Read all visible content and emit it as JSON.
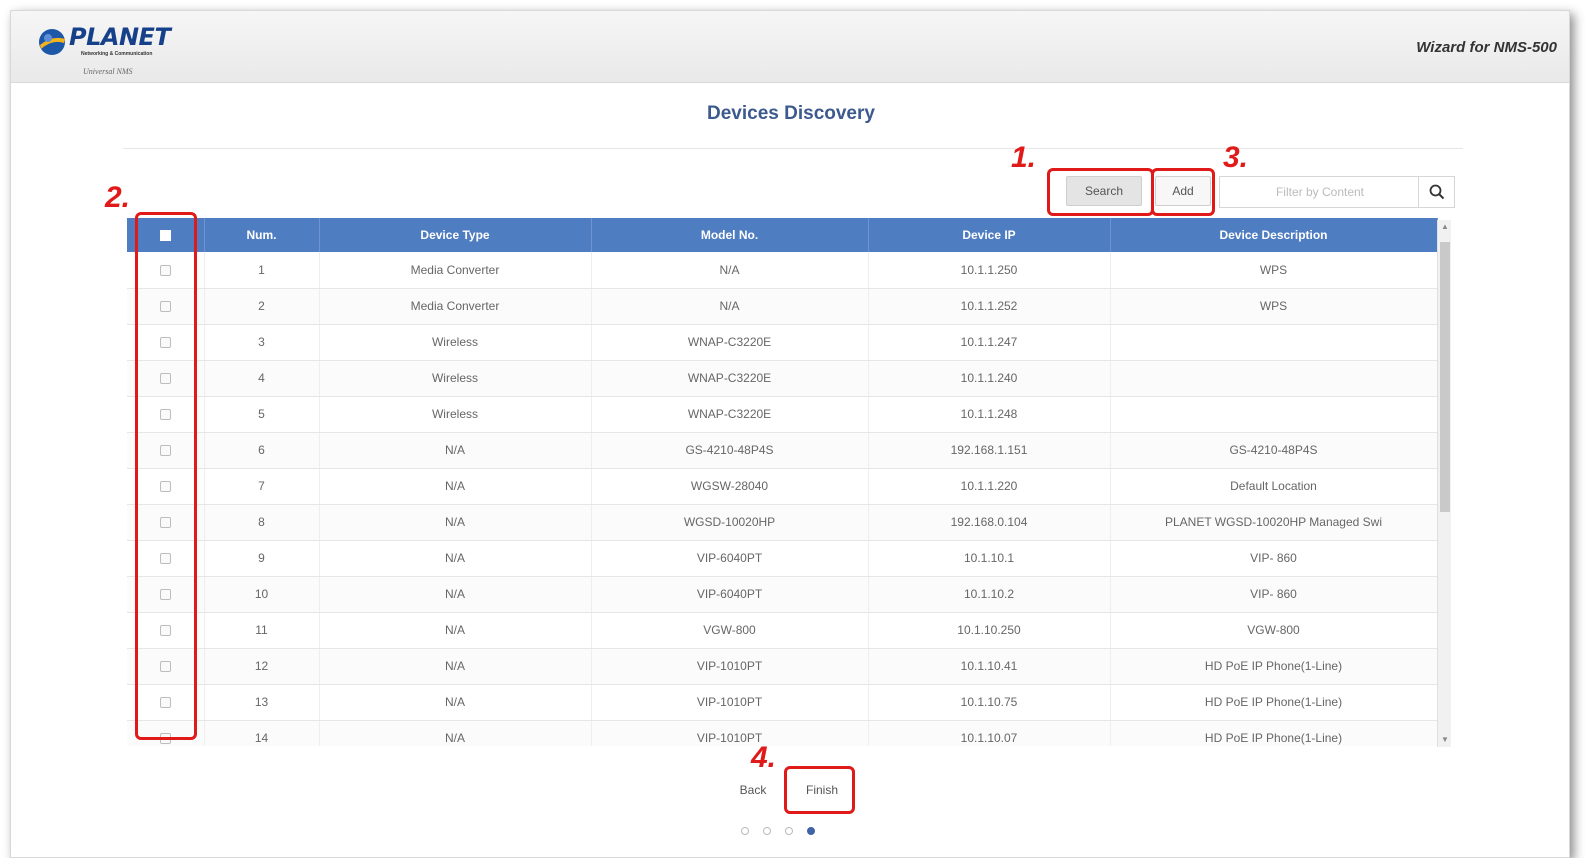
{
  "header": {
    "logo_text": "PLANET",
    "logo_tagline": "Networking & Communication",
    "logo_sub": "Universal NMS",
    "title": "Wizard for NMS-500"
  },
  "page_title": "Devices Discovery",
  "toolbar": {
    "search_label": "Search",
    "add_label": "Add",
    "filter_placeholder": "Filter by Content",
    "filter_icon": "search-icon"
  },
  "table": {
    "columns": [
      "Num.",
      "Device Type",
      "Model No.",
      "Device IP",
      "Device Description"
    ],
    "rows": [
      {
        "num": "1",
        "type": "Media Converter",
        "model": "N/A",
        "ip": "10.1.1.250",
        "desc": "WPS"
      },
      {
        "num": "2",
        "type": "Media Converter",
        "model": "N/A",
        "ip": "10.1.1.252",
        "desc": "WPS"
      },
      {
        "num": "3",
        "type": "Wireless",
        "model": "WNAP-C3220E",
        "ip": "10.1.1.247",
        "desc": ""
      },
      {
        "num": "4",
        "type": "Wireless",
        "model": "WNAP-C3220E",
        "ip": "10.1.1.240",
        "desc": ""
      },
      {
        "num": "5",
        "type": "Wireless",
        "model": "WNAP-C3220E",
        "ip": "10.1.1.248",
        "desc": ""
      },
      {
        "num": "6",
        "type": "N/A",
        "model": "GS-4210-48P4S",
        "ip": "192.168.1.151",
        "desc": "GS-4210-48P4S"
      },
      {
        "num": "7",
        "type": "N/A",
        "model": "WGSW-28040",
        "ip": "10.1.1.220",
        "desc": "Default Location"
      },
      {
        "num": "8",
        "type": "N/A",
        "model": "WGSD-10020HP",
        "ip": "192.168.0.104",
        "desc": "PLANET WGSD-10020HP Managed Swi"
      },
      {
        "num": "9",
        "type": "N/A",
        "model": "VIP-6040PT",
        "ip": "10.1.10.1",
        "desc": "VIP- 860"
      },
      {
        "num": "10",
        "type": "N/A",
        "model": "VIP-6040PT",
        "ip": "10.1.10.2",
        "desc": "VIP- 860"
      },
      {
        "num": "11",
        "type": "N/A",
        "model": "VGW-800",
        "ip": "10.1.10.250",
        "desc": "VGW-800"
      },
      {
        "num": "12",
        "type": "N/A",
        "model": "VIP-1010PT",
        "ip": "10.1.10.41",
        "desc": "HD PoE IP Phone(1-Line)"
      },
      {
        "num": "13",
        "type": "N/A",
        "model": "VIP-1010PT",
        "ip": "10.1.10.75",
        "desc": "HD PoE IP Phone(1-Line)"
      },
      {
        "num": "14",
        "type": "N/A",
        "model": "VIP-1010PT",
        "ip": "10.1.10.07",
        "desc": "HD PoE IP Phone(1-Line)"
      }
    ]
  },
  "nav": {
    "back_label": "Back",
    "finish_label": "Finish",
    "steps_total": 4,
    "steps_active": 4
  },
  "annotations": {
    "step1": "1.",
    "step2": "2.",
    "step3": "3.",
    "step4": "4."
  },
  "colors": {
    "accent": "#4f7dc1",
    "title": "#3c5a8e",
    "annotation": "#e01919"
  }
}
